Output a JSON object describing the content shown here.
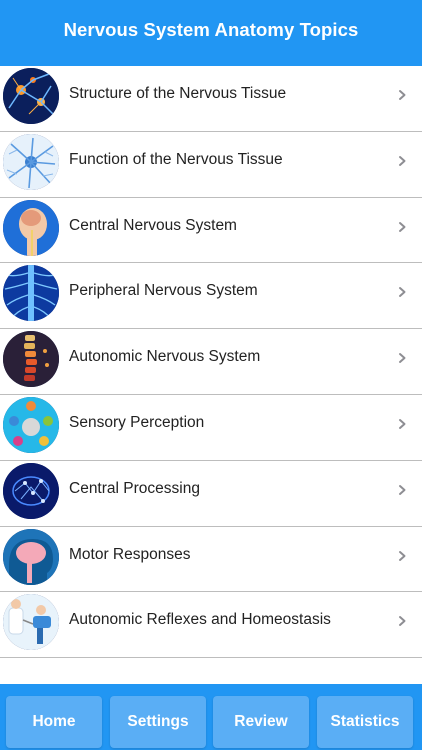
{
  "header": {
    "title": "Nervous System Anatomy Topics"
  },
  "topics": [
    {
      "label": "Structure of the Nervous Tissue",
      "icon": "neuron-network-icon"
    },
    {
      "label": "Function of the Nervous Tissue",
      "icon": "neuron-cell-icon"
    },
    {
      "label": "Central Nervous System",
      "icon": "head-anatomy-icon"
    },
    {
      "label": "Peripheral Nervous System",
      "icon": "spinal-nerves-icon"
    },
    {
      "label": "Autonomic Nervous System",
      "icon": "spine-icon"
    },
    {
      "label": "Sensory Perception",
      "icon": "senses-icon"
    },
    {
      "label": "Central Processing",
      "icon": "brain-network-icon"
    },
    {
      "label": "Motor Responses",
      "icon": "brain-profile-icon"
    },
    {
      "label": "Autonomic Reflexes and Homeostasis",
      "icon": "reflex-test-icon"
    }
  ],
  "tabs": {
    "home": "Home",
    "settings": "Settings",
    "review": "Review",
    "statistics": "Statistics"
  },
  "colors": {
    "primary": "#2196f3",
    "tab_button": "#5aaef5",
    "divider": "#bdbdbd",
    "text": "#222222",
    "chevron": "#8e8e93"
  }
}
